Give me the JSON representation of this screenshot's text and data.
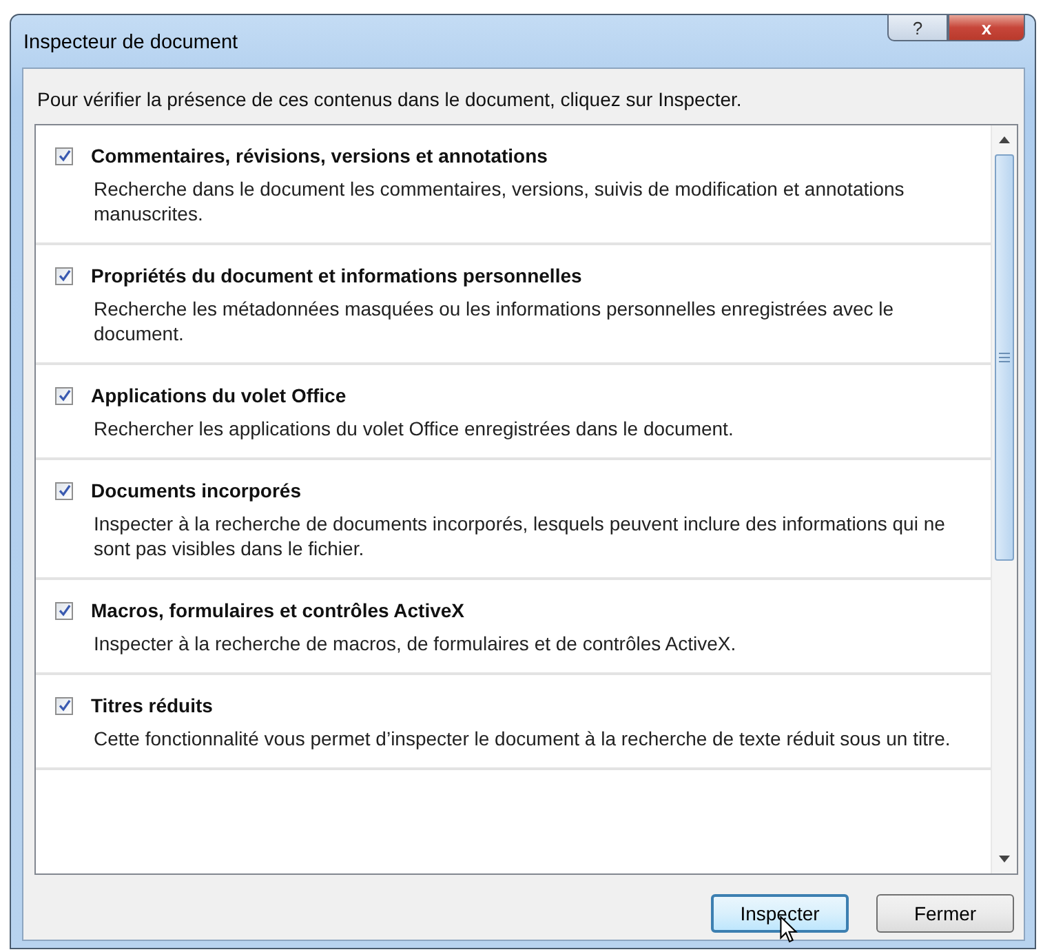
{
  "window": {
    "title": "Inspecteur de document",
    "controls": [
      "?",
      "x"
    ]
  },
  "instruction": "Pour vérifier la présence de ces contenus dans le document, cliquez sur Inspecter.",
  "sections": [
    {
      "title": "Commentaires, révisions, versions et annotations",
      "description": "Recherche dans le document les commentaires, versions, suivis de modification et annotations manuscrites.",
      "checked": true
    },
    {
      "title": "Propriétés du document et informations personnelles",
      "description": "Recherche les métadonnées masquées ou les informations personnelles enregistrées avec le document.",
      "checked": true
    },
    {
      "title": "Applications du volet Office",
      "description": "Rechercher les applications du volet Office enregistrées dans le document.",
      "checked": true
    },
    {
      "title": "Documents incorporés",
      "description": "Inspecter à la recherche de documents incorporés, lesquels peuvent inclure des informations qui ne sont pas visibles dans le fichier.",
      "checked": true
    },
    {
      "title": "Macros, formulaires et contrôles ActiveX",
      "description": "Inspecter à la recherche de macros, de formulaires et de contrôles ActiveX.",
      "checked": true
    },
    {
      "title": "Titres réduits",
      "description": "Cette fonctionnalité vous permet d’inspecter le document à la recherche de texte réduit sous un titre.",
      "checked": true
    }
  ],
  "buttons": [
    {
      "label": "Inspecter",
      "focused": true
    },
    {
      "label": "Fermer",
      "focused": false
    }
  ]
}
